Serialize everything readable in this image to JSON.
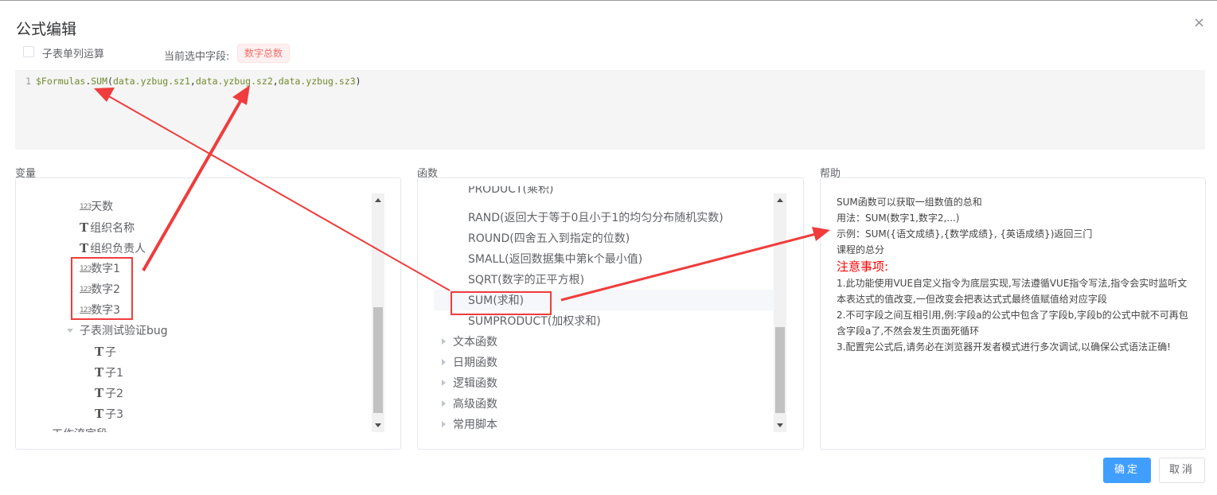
{
  "dialog": {
    "title": "公式编辑",
    "close_icon": "×"
  },
  "options": {
    "subtable_label": "子表单列运算",
    "current_field_label": "当前选中字段:",
    "current_field": "数字总数"
  },
  "editor": {
    "line_number": "1",
    "prefix": "$Formulas",
    "dot": ".",
    "func": "SUM",
    "open": "(",
    "args": [
      "data.yzbug.sz1",
      "data.yzbug.sz2",
      "data.yzbug.sz3"
    ],
    "comma": ",",
    "close": ")"
  },
  "variables": {
    "title": "变量",
    "items": [
      {
        "type": "number",
        "label": "天数"
      },
      {
        "type": "text",
        "label": "组织名称"
      },
      {
        "type": "text",
        "label": "组织负责人"
      },
      {
        "type": "number",
        "label": "数字1"
      },
      {
        "type": "number",
        "label": "数字2"
      },
      {
        "type": "number",
        "label": "数字3"
      }
    ],
    "group": "子表测试验证bug",
    "children": [
      {
        "label": "子"
      },
      {
        "label": "子1"
      },
      {
        "label": "子2"
      },
      {
        "label": "子3"
      }
    ],
    "clipped": "工作流字段",
    "icon_number": "123",
    "icon_text": "T"
  },
  "functions": {
    "title": "函数",
    "items": [
      "PRODUCT(乘积)",
      "RAND(返回大于等于0且小于1的均匀分布随机实数)",
      "ROUND(四舍五入到指定的位数)",
      "SMALL(返回数据集中第k个最小值)",
      "SQRT(数字的正平方根)",
      "SUM(求和)",
      "SUMPRODUCT(加权求和)"
    ],
    "selected": "SUM(求和)",
    "categories": [
      "文本函数",
      "日期函数",
      "逻辑函数",
      "高级函数",
      "常用脚本"
    ]
  },
  "help": {
    "title": "帮助",
    "lines": [
      "SUM函数可以获取一组数值的总和",
      "用法：SUM(数字1,数字2,...)",
      "示例：SUM({语文成绩},{数学成绩}, {英语成绩})返回三门课程的总分"
    ],
    "warning_title": "注意事项:",
    "notes": [
      "1.此功能使用VUE自定义指令为底层实现,写法遵循VUE指令写法,指令会实时监听文本表达式的值改变,一但改变会把表达式式最终值赋值给对应字段",
      "2.不可字段之间互相引用,例:字段a的公式中包含了字段b,字段b的公式中就不可再包含字段a了,不然会发生页面死循环",
      "3.配置完公式后,请务必在浏览器开发者模式进行多次调试,以确保公式语法正确!"
    ]
  },
  "buttons": {
    "ok": "确定",
    "cancel": "取消"
  },
  "colors": {
    "primary": "#409eff",
    "annotation": "#f03c3c",
    "tag_text": "#f56c6c"
  }
}
